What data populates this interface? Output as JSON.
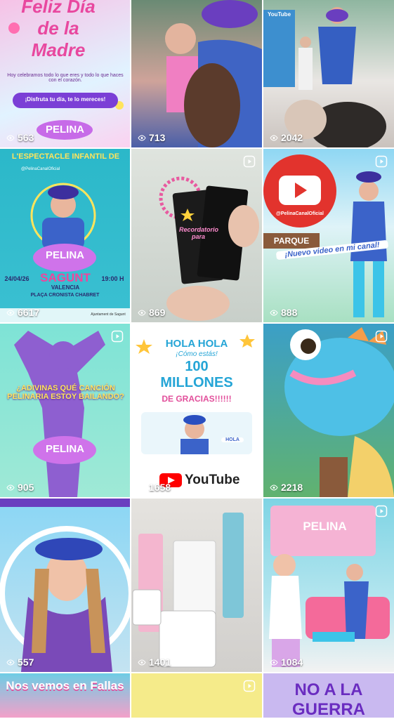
{
  "tiles": [
    {
      "views": "563",
      "reel": false,
      "title": "Feliz Día de la Madre",
      "sub": "Hoy celebramos todo lo que eres y todo lo que haces con el corazón.",
      "sub2": "¡Disfruta tu día, te lo mereces!",
      "brand": "PELINA"
    },
    {
      "views": "713",
      "reel": false
    },
    {
      "views": "2042",
      "reel": false,
      "sign": "YouTube"
    },
    {
      "views": "6617",
      "reel": false,
      "title": "L'ESPECTACLE INFANTIL DE",
      "handle": "@PelinaCanalOficial",
      "brand": "PELINA",
      "place": "SAGUNT",
      "date": "24/04/26",
      "time": "19:00 H",
      "region": "VALENCIA",
      "venue": "PLAÇA CRONISTA CHABRET",
      "sponsor": "Ajuntament de Sagunt"
    },
    {
      "views": "869",
      "reel": true,
      "card": "Recordatorio para"
    },
    {
      "views": "888",
      "reel": true,
      "handle": "@PelinaCanalOficial",
      "park": "PARQUE",
      "banner": "¡Nuevo video en mi canal!"
    },
    {
      "views": "905",
      "reel": true,
      "title": "¿ADIVINAS QUÉ CANCIÓN PELINARIA ESTOY BAILANDO?",
      "brand": "PELINA"
    },
    {
      "views": "1658",
      "reel": false,
      "h1": "HOLA HOLA",
      "h2": "¡Cómo estás!",
      "h3": "100",
      "h4": "MILLONES",
      "h5": "DE GRACIAS!!!!!!",
      "yt": "YouTube",
      "hola": "HOLA"
    },
    {
      "views": "2218",
      "reel": true
    },
    {
      "views": "557",
      "reel": false
    },
    {
      "views": "1401",
      "reel": false
    },
    {
      "views": "1084",
      "reel": true,
      "brand": "PELINA"
    },
    {
      "views": "",
      "reel": false,
      "title": "Nos vemos en Fallas"
    },
    {
      "views": "",
      "reel": true
    },
    {
      "views": "",
      "reel": false,
      "title": "NO A LA GUERRA"
    }
  ],
  "colors": {
    "overlay_text": "#ffffff",
    "youtube_red": "#ff0000",
    "brand_purple": "#8e3fd0"
  }
}
